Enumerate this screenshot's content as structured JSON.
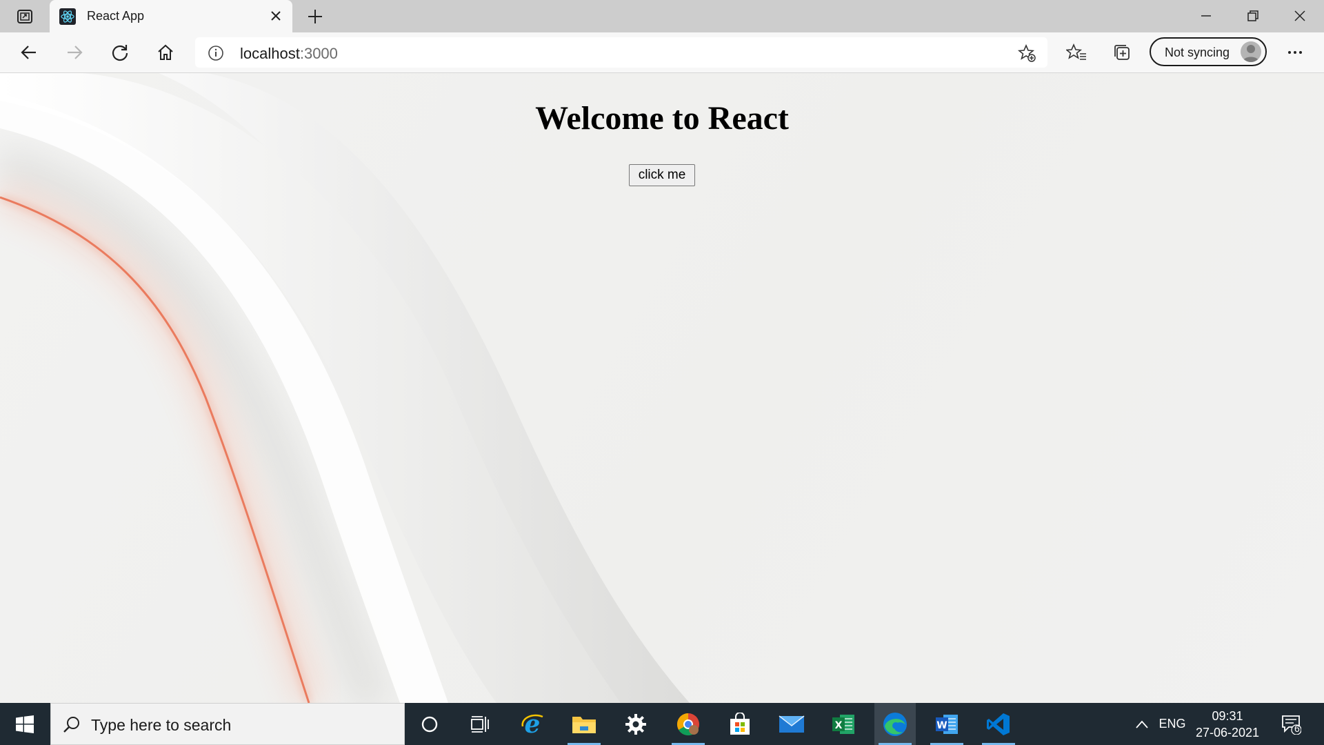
{
  "browser": {
    "tab": {
      "title": "React App"
    },
    "address_bar": {
      "url_host": "localhost",
      "url_port": ":3000"
    },
    "profile": {
      "sync_label": "Not syncing"
    }
  },
  "page": {
    "heading": "Welcome to React",
    "button_label": "click me"
  },
  "taskbar": {
    "search_placeholder": "Type here to search",
    "apps": [
      "cortana",
      "task-view",
      "internet-explorer",
      "file-explorer",
      "settings",
      "chrome",
      "microsoft-store",
      "mail",
      "excel",
      "edge",
      "word",
      "vscode"
    ],
    "active_app": "edge",
    "language": "ENG",
    "time": "09:31",
    "date": "27-06-2021",
    "notification_count": "6"
  },
  "colors": {
    "taskbar_bg": "#1f2a33",
    "active_underline": "#76b9ed",
    "accent_stripe": "#f08a6e"
  }
}
